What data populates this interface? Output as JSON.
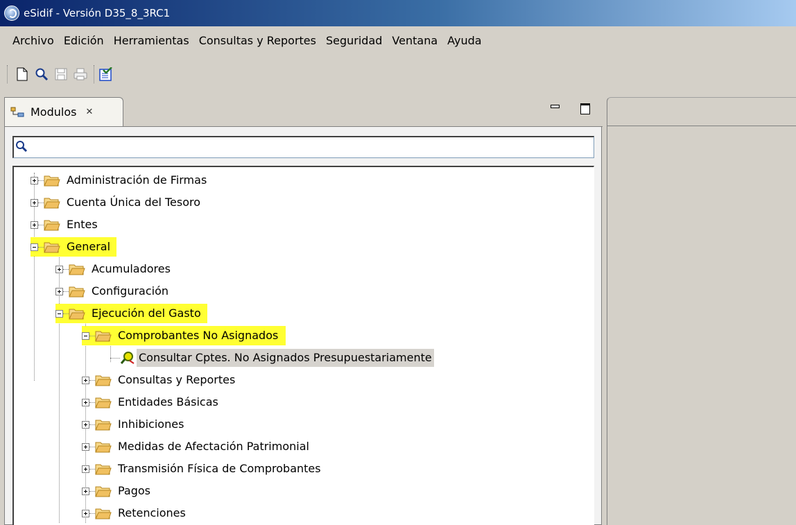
{
  "window": {
    "title": "eSidif - Versión D35_8_3RC1"
  },
  "menu": [
    "Archivo",
    "Edición",
    "Herramientas",
    "Consultas y Reportes",
    "Seguridad",
    "Ventana",
    "Ayuda"
  ],
  "toolbar": {
    "icons": [
      "new-document-icon",
      "search-icon",
      "save-icon",
      "print-icon",
      "checklist-icon"
    ]
  },
  "modules_view": {
    "tab_label": "Modulos",
    "search": {
      "value": "",
      "placeholder": ""
    },
    "tree": [
      {
        "label": "Administración de Firmas",
        "state": "collapsed",
        "highlight": false
      },
      {
        "label": "Cuenta Única del Tesoro",
        "state": "collapsed",
        "highlight": false
      },
      {
        "label": "Entes",
        "state": "collapsed",
        "highlight": false
      },
      {
        "label": "General",
        "state": "expanded",
        "highlight": true
      },
      {
        "label": "Acumuladores",
        "state": "collapsed",
        "highlight": false
      },
      {
        "label": "Configuración",
        "state": "collapsed",
        "highlight": false
      },
      {
        "label": "Ejecución del Gasto",
        "state": "expanded",
        "highlight": true
      },
      {
        "label": "Comprobantes No Asignados",
        "state": "expanded",
        "highlight": true
      },
      {
        "label": "Consultar Cptes. No Asignados Presupuestariamente",
        "state": "leaf",
        "selected": true
      },
      {
        "label": "Consultas y Reportes",
        "state": "collapsed",
        "highlight": false
      },
      {
        "label": "Entidades Básicas",
        "state": "collapsed",
        "highlight": false
      },
      {
        "label": "Inhibiciones",
        "state": "collapsed",
        "highlight": false
      },
      {
        "label": "Medidas de Afectación Patrimonial",
        "state": "collapsed",
        "highlight": false
      },
      {
        "label": "Transmisión Física de Comprobantes",
        "state": "collapsed",
        "highlight": false
      },
      {
        "label": "Pagos",
        "state": "collapsed",
        "highlight": false
      },
      {
        "label": "Retenciones",
        "state": "collapsed",
        "highlight": false
      }
    ]
  },
  "colors": {
    "highlight": "#ffff33",
    "selected": "#d6d3ce",
    "folder": "#f0c060"
  }
}
